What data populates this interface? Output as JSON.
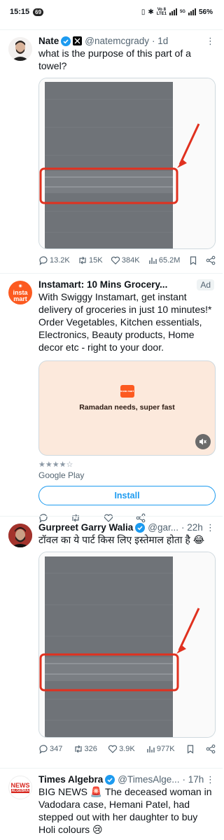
{
  "status_bar": {
    "time": "15:15",
    "notif_count": "69",
    "network_top": "Vo 8",
    "network_bottom": "LTE1",
    "net2": "5G",
    "battery": "56%"
  },
  "tweets": [
    {
      "name": "Nate",
      "handle": "@natemcgrady",
      "time": "· 1d",
      "text": "what is the purpose of this part of a towel?",
      "replies": "13.2K",
      "retweets": "15K",
      "likes": "384K",
      "views": "65.2M"
    },
    {
      "name": "Instamart: 10 Mins Grocery...",
      "ad_label": "Ad",
      "text": "With Swiggy Instamart, get instant delivery of groceries in just 10 minutes!* Order Vegetables, Kitchen essentials, Electronics, Beauty products, Home decor etc - right to your door.",
      "media_headline": "Ramadan needs, super fast",
      "logo_text": "insta mart",
      "rating": "4.5",
      "store": "Google Play",
      "button": "Install"
    },
    {
      "name": "Gurpreet Garry Walia",
      "handle": "@gar...",
      "time": "· 22h",
      "text": "टॉवल का ये पार्ट किस लिए इस्तेमाल होता है 😂",
      "replies": "347",
      "retweets": "326",
      "likes": "3.9K",
      "views": "977K"
    },
    {
      "name": "Times Algebra",
      "handle": "@TimesAlge...",
      "time": "· 17h",
      "text": "BIG NEWS 🚨 The deceased woman in Vadodara case, Hemani Patel, had stepped out with her daughter to buy Holi colours 😢",
      "logo_top": "NEWS",
      "logo_bottom": "ALGEBRA"
    }
  ],
  "colors": {
    "accent": "#1d9bf0",
    "annotation_red": "#e0311f",
    "towel": "#6f7378",
    "ad_bg": "#fce9dc",
    "instamart_orange": "#fc5a20"
  }
}
